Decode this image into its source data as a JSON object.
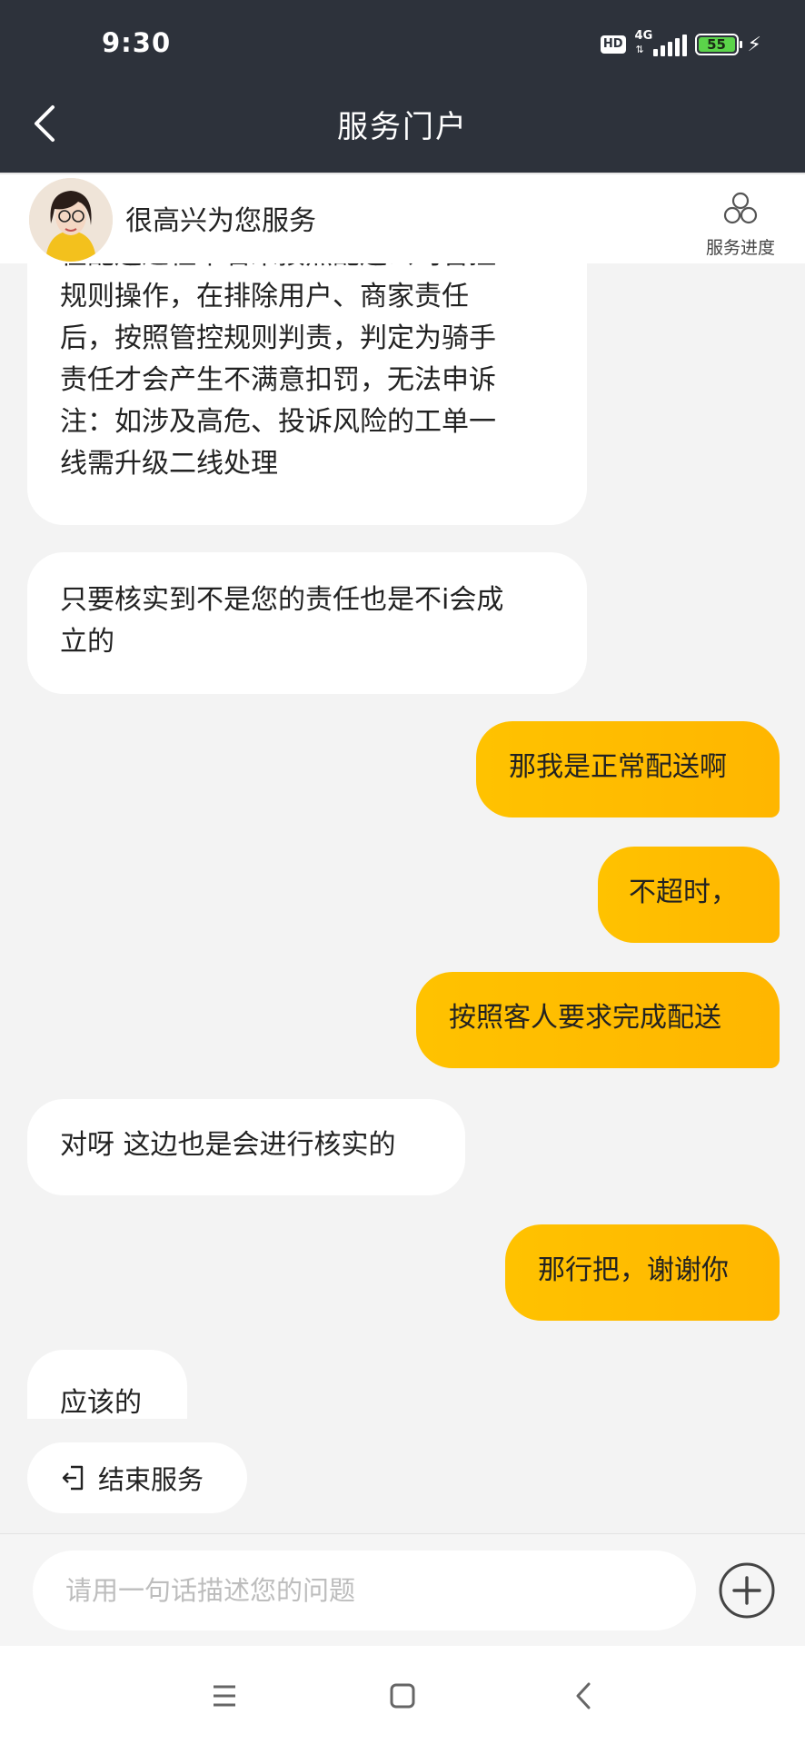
{
  "status_bar": {
    "time": "9:30",
    "hd": "HD",
    "network": "4G",
    "battery": "55",
    "icons": [
      "signal-icon",
      "battery-icon",
      "charging-icon"
    ]
  },
  "header": {
    "title": "服务门户",
    "back_icon": "back-arrow-icon"
  },
  "agent": {
    "greeting": "很高兴为您服务",
    "progress_label": "服务进度",
    "progress_icon": "three-circles-icon"
  },
  "messages": [
    {
      "side": "left",
      "text": "在配送过程中若未按照配送公司管控规则操作，在排除用户、商家责任后，按照管控规则判责，判定为骑手责任才会产生不满意扣罚，无法申诉注：如涉及高危、投诉风险的工单一线需升级二线处理"
    },
    {
      "side": "left",
      "text": "只要核实到不是您的责任也是不i会成立的"
    },
    {
      "side": "right",
      "text": "那我是正常配送啊"
    },
    {
      "side": "right",
      "text": "不超时，"
    },
    {
      "side": "right",
      "text": "按照客人要求完成配送"
    },
    {
      "side": "left",
      "text": "对呀 这边也是会进行核实的"
    },
    {
      "side": "right",
      "text": "那行把，谢谢你"
    },
    {
      "side": "left",
      "text": "应该的"
    }
  ],
  "bubble_lines": {
    "m0": [
      "在配送过程中若未按照配送公司管控",
      "规则操作，在排除用户、商家责任",
      "后，按照管控规则判责，判定为骑手",
      "责任才会产生不满意扣罚，无法申诉",
      "注：如涉及高危、投诉风险的工单一",
      "线需升级二线处理"
    ],
    "m1": [
      "只要核实到不是您的责任也是不i会成",
      "立的"
    ]
  },
  "actions": {
    "end_service": "结束服务",
    "end_service_icon": "exit-icon"
  },
  "input": {
    "placeholder": "请用一句话描述您的问题",
    "plus_icon": "plus-circle-icon"
  },
  "nav": {
    "icons": [
      "menu-icon",
      "home-square-icon",
      "back-icon"
    ]
  },
  "colors": {
    "header_bg": "#2d323b",
    "bubble_right": "#ffbf00",
    "bubble_left": "#ffffff",
    "page_bg": "#f3f3f3"
  }
}
